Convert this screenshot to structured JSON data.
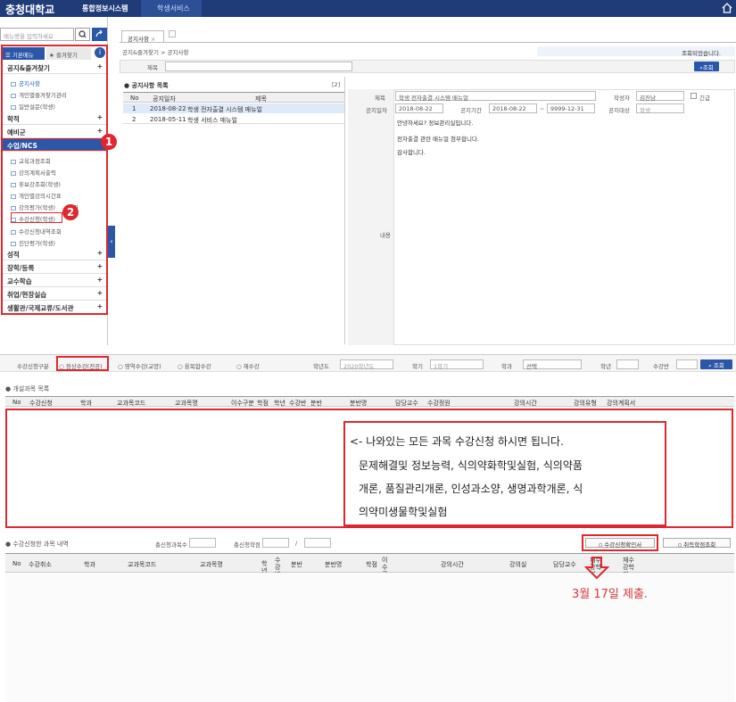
{
  "header": {
    "logo": "충청대학교",
    "system": "통합정보시스템",
    "tab": "학생서비스"
  },
  "sidebar": {
    "search_placeholder": "메뉴명을 입력하세요",
    "tab_basic": "기본메뉴",
    "tab_fav": "즐겨찾기",
    "groups": [
      {
        "label": "공지&즐겨찾기"
      },
      {
        "label": "학적"
      },
      {
        "label": "예비군"
      },
      {
        "label": "수업/NCS"
      },
      {
        "label": "성적"
      },
      {
        "label": "장학/등록"
      },
      {
        "label": "교수학습"
      },
      {
        "label": "취업/현장실습"
      },
      {
        "label": "생활관/국제교류/도서관"
      }
    ],
    "notice_items": [
      "공지사항",
      "개인별즐겨찾기관리",
      "일반설문(학생)"
    ],
    "class_items": [
      "교육과정조회",
      "강의계획서출력",
      "휴보강조회(학생)",
      "개인별강의시간표",
      "강의평가(학생)",
      "수강신청(학생)",
      "수강신청내역조회",
      "진단평가(학생)"
    ],
    "class_item_5_partial": "입력"
  },
  "annotations": {
    "n1": "1",
    "n2": "2"
  },
  "notice": {
    "tab": "공지사항",
    "tab_close": "×",
    "breadcrumb": "공지&즐겨찾기 > 공지사항",
    "status": "조회되었습니다.",
    "search_label": "제목",
    "search_btn": "조회",
    "list_title": "공지사항 목록",
    "list_count": "[2]",
    "cols": [
      "No",
      "공지일자",
      "제목"
    ],
    "rows": [
      {
        "no": "1",
        "date": "2018-08-22",
        "title": "학생 전자출결 시스템 매뉴얼"
      },
      {
        "no": "2",
        "date": "2018-05-11",
        "title": "학생 서비스 매뉴얼"
      }
    ],
    "detail": {
      "title_label": "제목",
      "title_value": "학생 전자출결 시스템 매뉴얼",
      "author_label": "작성자",
      "author_value": "김진남",
      "urgent_label": "긴급",
      "date_label": "공지일자",
      "date_value": "2018-08-22",
      "period_label": "공지기간",
      "period_from": "2018-08-22",
      "period_sep": "~",
      "period_to": "9999-12-31",
      "target_label": "공지대상",
      "target_value": "학생",
      "content_label": "내용",
      "content": [
        "안녕하세요? 정보관리실입니다.",
        "전자출결 관련 매뉴얼 첨부합니다.",
        "감사합니다."
      ]
    }
  },
  "reg": {
    "type_label": "수강신청구분",
    "types": [
      "정상수강(전공)",
      "영역수강(교양)",
      "융복합수강",
      "재수강"
    ],
    "year_label": "학년도",
    "year_value": "2020학년도",
    "term_label": "학기",
    "term_value": "1학기",
    "dept_label": "학과",
    "dept_value": "선택",
    "grade_label": "학년",
    "class_label": "수강반",
    "search_btn": "조회",
    "open_title": "개설과목 목록",
    "open_cols": [
      "No",
      "수강신청",
      "학과",
      "교과목코드",
      "교과목명",
      "이수구분",
      "학점",
      "학년",
      "수강반",
      "분반",
      "분반명",
      "담당교수",
      "수강정원",
      "강의시간",
      "강의유형",
      "강의계획서"
    ],
    "callout": [
      "<- 나와있는 모든 과목 수강신청 하시면 됩니다.",
      "문제해결및 정보능력, 식의약화학및실험, 식의약품",
      "개론, 품질관리개론, 인성과소양, 생명과학개론, 식",
      "의약미생물학및실험"
    ],
    "done_title": "수강신청한 과목 내역",
    "count_label": "총신청과목수",
    "credit_label": "총신청학점",
    "slash": "/",
    "confirm_btn": "수강신청확인서",
    "cancel_btn": "취득학점조회",
    "done_cols": [
      "No",
      "수강취소",
      "학과",
      "교과목코드",
      "교과목명",
      "학년",
      "수강반",
      "분반",
      "분반명",
      "학점",
      "이수구분",
      "강의시간",
      "강의실",
      "담당교수",
      "재수강학년",
      "재수강학기"
    ],
    "due": "3월 17일 제출."
  },
  "colors": {
    "navy": "#1f3b78",
    "blue": "#2b57a8",
    "red": "#e0262e"
  }
}
